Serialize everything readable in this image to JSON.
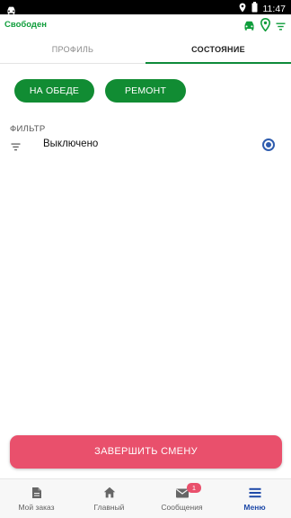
{
  "system": {
    "time": "11:47"
  },
  "appbar": {
    "status": "Свободен",
    "icons": [
      "car-icon",
      "location-pin-icon",
      "filter-icon"
    ]
  },
  "tabs": [
    {
      "label": "ПРОФИЛЬ",
      "active": false
    },
    {
      "label": "СОСТОЯНИЕ",
      "active": true
    }
  ],
  "status_buttons": {
    "lunch": "НА ОБЕДЕ",
    "repair": "РЕМОНТ"
  },
  "filter": {
    "header": "ФИЛЬТР",
    "option_label": "Выключено",
    "selected": true
  },
  "end_shift": {
    "label": "ЗАВЕРШИТЬ СМЕНУ"
  },
  "bottom_nav": [
    {
      "label": "Мой заказ",
      "icon": "document-icon",
      "active": false
    },
    {
      "label": "Главный",
      "icon": "home-icon",
      "active": false
    },
    {
      "label": "Сообщения",
      "icon": "mail-icon",
      "active": false,
      "badge": "1"
    },
    {
      "label": "Меню",
      "icon": "menu-icon",
      "active": true
    }
  ],
  "colors": {
    "accent_green": "#118c33",
    "status_green": "#0f9d3b",
    "danger_pink": "#e9506c",
    "active_blue": "#1f4aa8"
  }
}
